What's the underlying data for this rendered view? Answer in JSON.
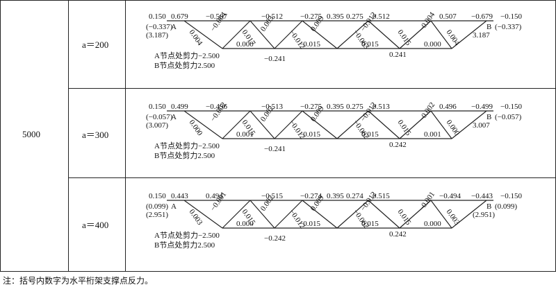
{
  "span": "5000",
  "note": "注：括号内数字为水平桁架支撑点反力。",
  "rows": [
    {
      "a_label": "a＝200",
      "top": {
        "c1": "0.150",
        "c2": "0.679",
        "c3": "−0.507",
        "c4": "−0.512",
        "c5": "−0.275",
        "c6": "0.395",
        "c7": "0.275",
        "c8": "0.512",
        "c9": "0.507",
        "c10": "−0.679",
        "c11": "−0.150"
      },
      "left_react": "(−0.337)",
      "right_react": "(−0.337)",
      "left_val": "(3.187)",
      "right_val": "3.187",
      "node_a": "A",
      "node_b": "B",
      "diags": [
        "0.004",
        "−0.004",
        "0.017",
        "0.003",
        "−0.012",
        "0.009",
        "−0.003",
        "−0.012",
        "0.015",
        "−0.004",
        "0.004"
      ],
      "bottom": {
        "b1": "0.000",
        "b2": "−0.015",
        "b3": "0.015",
        "b4": "0.000"
      },
      "low_left": "−0.241",
      "low_right": "0.241",
      "shear_a": "A节点处剪力−2.500",
      "shear_b": "B节点处剪力2.500"
    },
    {
      "a_label": "a＝300",
      "top": {
        "c1": "0.150",
        "c2": "0.499",
        "c3": "−0.496",
        "c4": "−0.513",
        "c5": "−0.275",
        "c6": "0.395",
        "c7": "0.275",
        "c8": "0.513",
        "c9": "0.496",
        "c10": "−0.499",
        "c11": "−0.150"
      },
      "left_react": "(−0.057)",
      "right_react": "(−0.057)",
      "left_val": "(3.007)",
      "right_val": "3.007",
      "node_a": "A",
      "node_b": "B",
      "diags": [
        "0.000",
        "−0.002",
        "0.015",
        "0.002",
        "−0.012",
        "0.009",
        "−0.002",
        "−0.012",
        "0.015",
        "−0.002",
        "0.000"
      ],
      "bottom": {
        "b1": "0.001",
        "b2": "−0.015",
        "b3": "0.015",
        "b4": "0.001"
      },
      "low_left": "−0.241",
      "low_right": "0.242",
      "shear_a": "A节点处剪力−2.500",
      "shear_b": "B节点处剪力2.500"
    },
    {
      "a_label": "a＝400",
      "top": {
        "c1": "0.150",
        "c2": "0.443",
        "c3": "0.494",
        "c4": "−0.515",
        "c5": "−0.274",
        "c6": "0.395",
        "c7": "0.274",
        "c8": "0.515",
        "c9": "−0.494",
        "c10": "−0.443",
        "c11": "−0.150"
      },
      "left_react": "(0.099)",
      "right_react": "(0.099)",
      "left_val": "(2.951)",
      "right_val": "(2.951)",
      "node_a": "A",
      "node_b": "B",
      "diags": [
        "0.003",
        "−0.001",
        "0.015",
        "0.002",
        "−0.012",
        "0.009",
        "−0.002",
        "−0.012",
        "0.015",
        "−0.001",
        "0.003"
      ],
      "bottom": {
        "b1": "0.000",
        "b2": "−0.015",
        "b3": "0.015",
        "b4": "0.000"
      },
      "low_left": "−0.242",
      "low_right": "0.242",
      "shear_a": "A节点处剪力−2.500",
      "shear_b": "B节点处剪力2.500"
    }
  ]
}
